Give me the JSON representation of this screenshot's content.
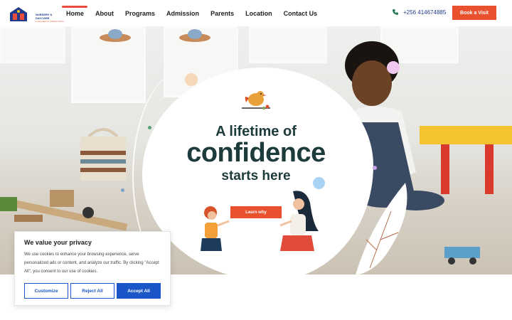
{
  "logo": {
    "name": "NURSERY & DAYCARE",
    "tagline": "a Jumpstart to a Better Future"
  },
  "nav": {
    "items": [
      {
        "label": "Home",
        "active": true
      },
      {
        "label": "About",
        "active": false
      },
      {
        "label": "Programs",
        "active": false
      },
      {
        "label": "Admission",
        "active": false
      },
      {
        "label": "Parents",
        "active": false
      },
      {
        "label": "Location",
        "active": false
      },
      {
        "label": "Contact Us",
        "active": false
      }
    ]
  },
  "header": {
    "phone": "+256 414674885",
    "phone_icon": "phone-icon",
    "cta_label": "Book a Visit"
  },
  "hero": {
    "line1": "A lifetime of",
    "line2": "confidence",
    "line3": "starts here",
    "button_label": "Learn why"
  },
  "cookie": {
    "title": "We value your privacy",
    "text": "We use cookies to enhance your browsing experience, serve personalized ads or content, and analyze our traffic. By clicking \"Accept All\", you consent to our use of cookies.",
    "customize_label": "Customize",
    "reject_label": "Reject All",
    "accept_label": "Accept All"
  },
  "colors": {
    "accent": "#e8502e",
    "brand_blue": "#1a56c8",
    "headline": "#1d3b3a"
  }
}
